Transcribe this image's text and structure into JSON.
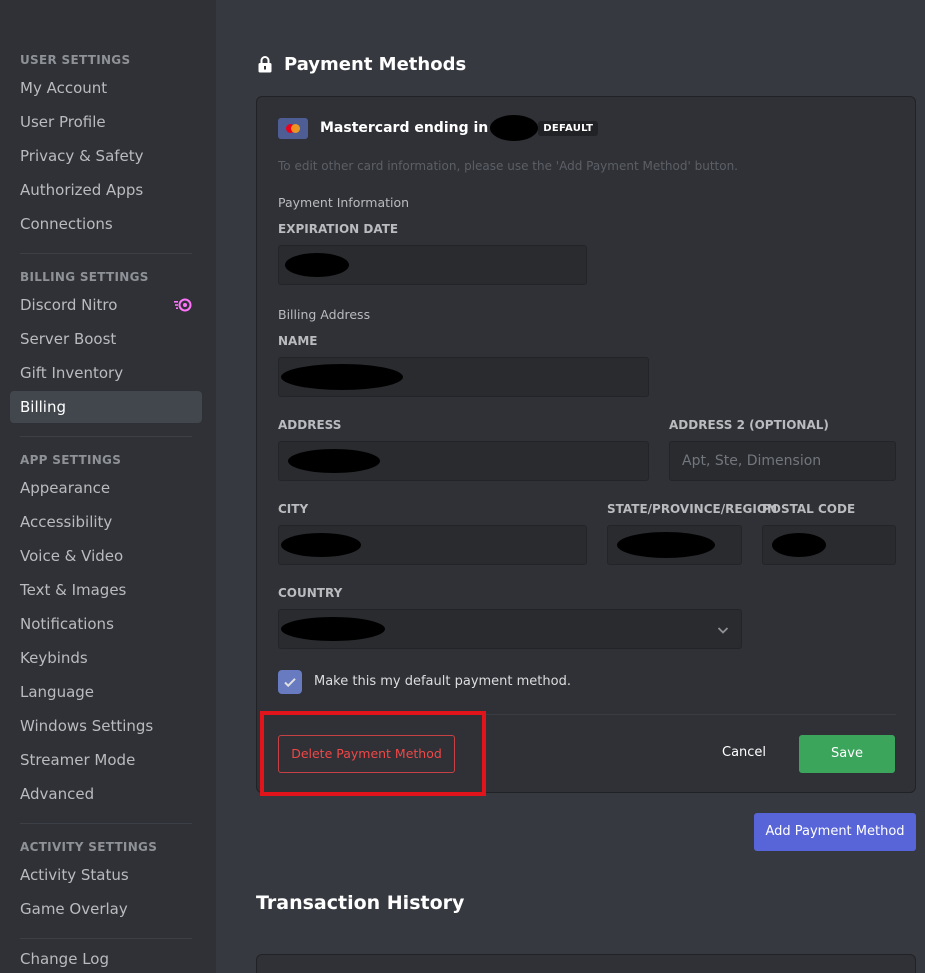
{
  "sidebar": {
    "user_settings": {
      "heading": "USER SETTINGS",
      "items": [
        "My Account",
        "User Profile",
        "Privacy & Safety",
        "Authorized Apps",
        "Connections"
      ]
    },
    "billing_settings": {
      "heading": "BILLING SETTINGS",
      "items": [
        "Discord Nitro",
        "Server Boost",
        "Gift Inventory",
        "Billing"
      ]
    },
    "app_settings": {
      "heading": "APP SETTINGS",
      "items": [
        "Appearance",
        "Accessibility",
        "Voice & Video",
        "Text & Images",
        "Notifications",
        "Keybinds",
        "Language",
        "Windows Settings",
        "Streamer Mode",
        "Advanced"
      ]
    },
    "activity_settings": {
      "heading": "ACTIVITY SETTINGS",
      "items": [
        "Activity Status",
        "Game Overlay"
      ]
    },
    "changelog": "Change Log",
    "active_item": "Billing"
  },
  "main": {
    "title": "Payment Methods",
    "card": {
      "label": "Mastercard ending in",
      "badge": "DEFAULT",
      "hint": "To edit other card information, please use the 'Add Payment Method' button."
    },
    "payment_info": {
      "heading": "Payment Information",
      "expiration_label": "EXPIRATION DATE"
    },
    "billing_address": {
      "heading": "Billing Address",
      "name_label": "NAME",
      "address_label": "ADDRESS",
      "address2_label": "ADDRESS 2 (OPTIONAL)",
      "address2_placeholder": "Apt, Ste, Dimension",
      "city_label": "CITY",
      "state_label": "STATE/PROVINCE/REGION",
      "postal_label": "POSTAL CODE",
      "country_label": "COUNTRY"
    },
    "default_checkbox": {
      "label": "Make this my default payment method.",
      "checked": true
    },
    "delete_label": "Delete Payment Method",
    "cancel_label": "Cancel",
    "save_label": "Save",
    "add_label": "Add Payment Method",
    "transaction_title": "Transaction History"
  },
  "colors": {
    "accent": "#5865d8",
    "save": "#3ba55c",
    "danger": "#f04747",
    "highlight": "#e0141a"
  }
}
